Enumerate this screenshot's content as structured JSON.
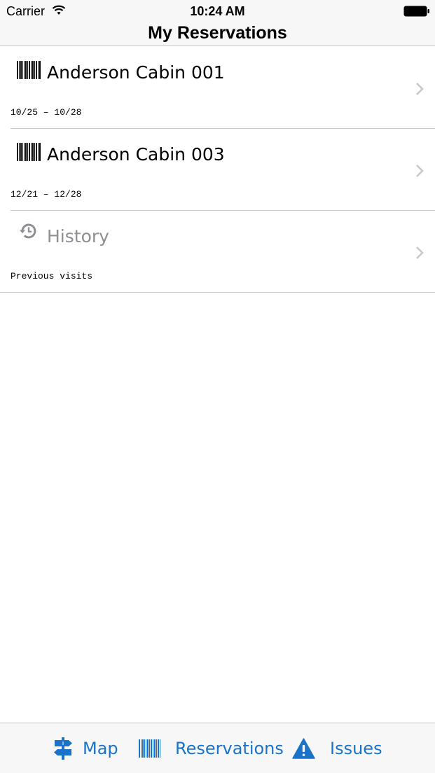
{
  "status_bar": {
    "carrier": "Carrier",
    "time": "10:24 AM"
  },
  "nav": {
    "title": "My Reservations"
  },
  "reservations": [
    {
      "icon": "barcode-icon",
      "title": "Anderson Cabin 001",
      "dates": "10/25 – 10/28"
    },
    {
      "icon": "barcode-icon",
      "title": "Anderson Cabin 003",
      "dates": "12/21 – 12/28"
    }
  ],
  "history": {
    "icon": "history-icon",
    "title": "History",
    "subtitle": "Previous visits"
  },
  "tabbar": {
    "accent": "#1a73c8",
    "tabs": [
      {
        "icon": "signpost-icon",
        "label": "Map"
      },
      {
        "icon": "barcode-icon",
        "label": "Reservations"
      },
      {
        "icon": "warning-icon",
        "label": "Issues"
      }
    ]
  }
}
